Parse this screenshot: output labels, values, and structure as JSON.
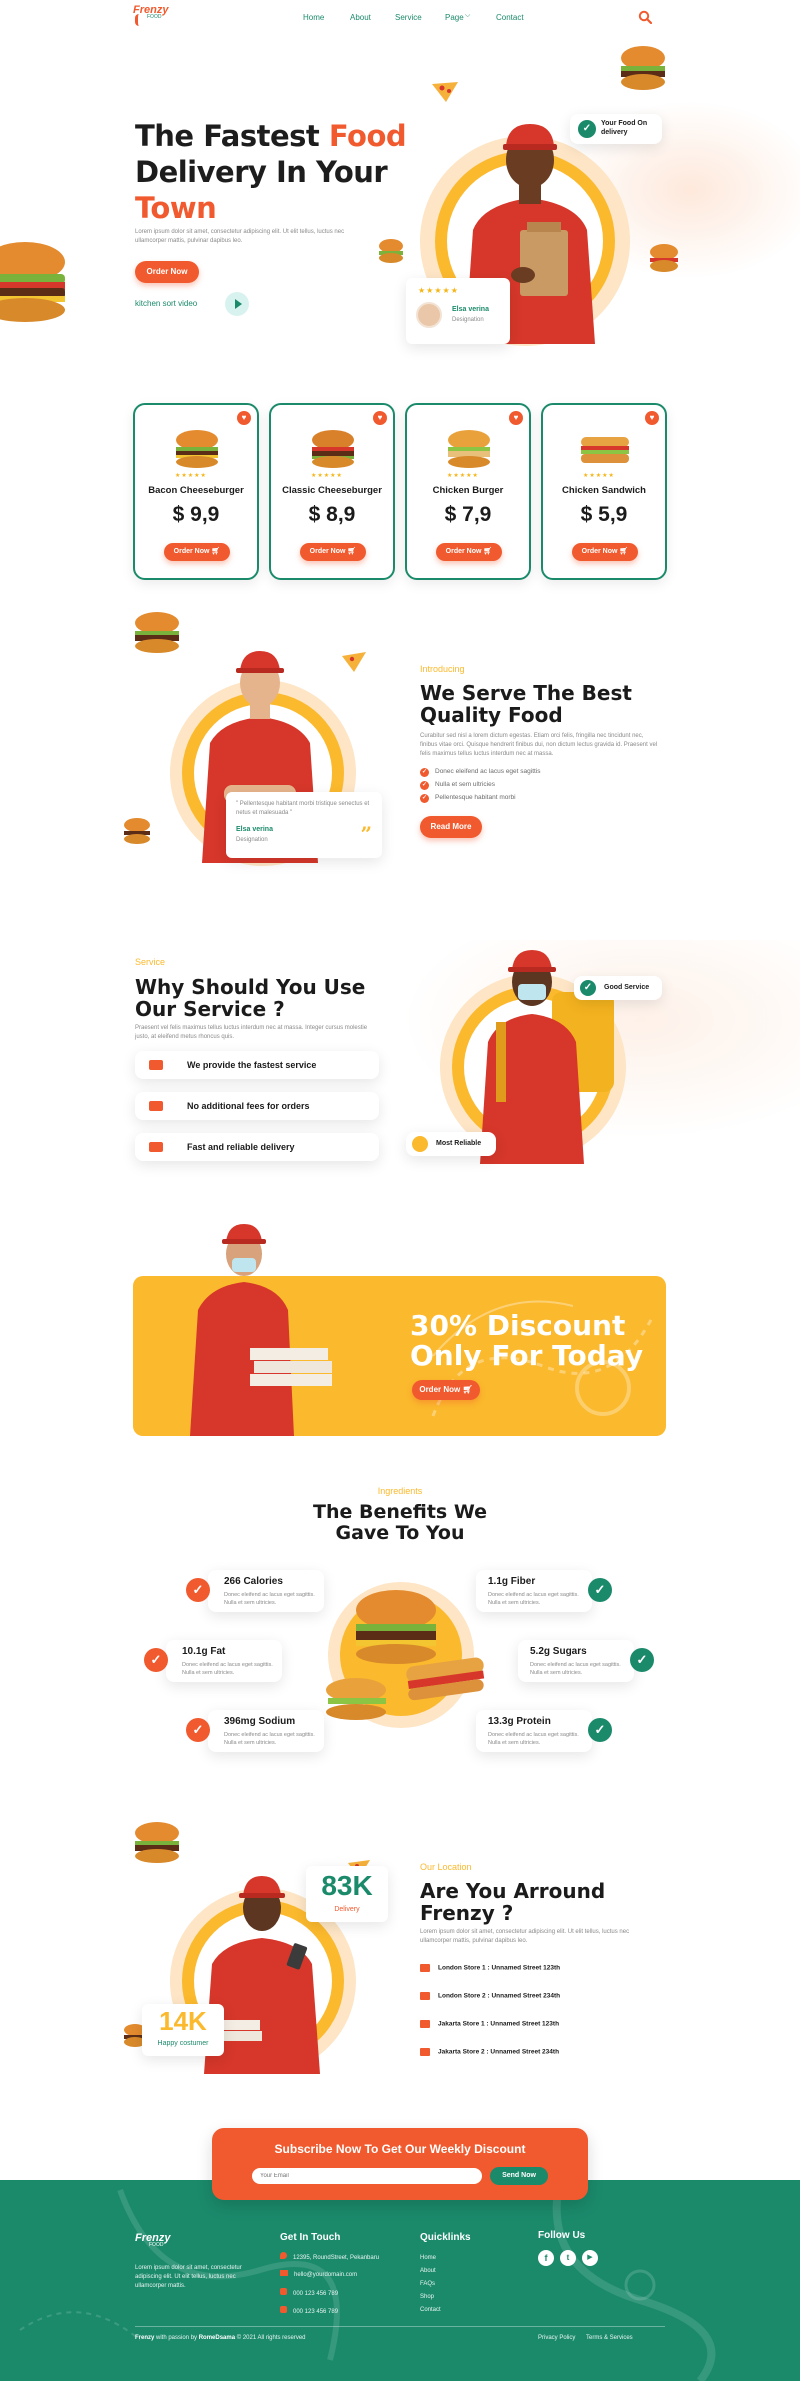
{
  "nav": {
    "logo": "Frenzy",
    "logo_sub": "FOOD",
    "links": [
      "Home",
      "About",
      "Service",
      "Page",
      "Contact"
    ],
    "page_caret": "⌵"
  },
  "hero": {
    "title_1": "The Fastest ",
    "title_food": "Food",
    "title_2": "Delivery In Your",
    "title_town": "Town",
    "desc": "Lorem ipsum dolor sit amet, consectetur adipiscing elit. Ut elit tellus, luctus nec ullamcorper mattis, pulvinar dapibus leo.",
    "order_button": "Order Now",
    "video_label": "kitchen sort video",
    "badge_text": "Your Food On delivery",
    "review_stars": "★★★★★",
    "review_name": "Elsa verina",
    "review_role": "Designation"
  },
  "products": [
    {
      "name": "Bacon Cheeseburger",
      "price": "$ 9,9",
      "stars": "★★★★★",
      "button": "Order Now"
    },
    {
      "name": "Classic Cheeseburger",
      "price": "$ 8,9",
      "stars": "★★★★★",
      "button": "Order Now"
    },
    {
      "name": "Chicken Burger",
      "price": "$ 7,9",
      "stars": "★★★★★",
      "button": "Order Now"
    },
    {
      "name": "Chicken Sandwich",
      "price": "$ 5,9",
      "stars": "★★★★★",
      "button": "Order Now"
    }
  ],
  "about": {
    "eyebrow": "Introducing",
    "title": "We Serve The Best Quality Food",
    "desc": "Curabitur sed nisl a lorem dictum egestas. Etiam orci felis, fringilla nec tincidunt nec, finibus vitae orci. Quisque hendrerit finibus dui, non dictum lectus gravida id. Praesent vel felis maximus tellus luctus interdum nec at massa.",
    "points": [
      "Donec eleifend ac lacus eget sagittis",
      "Nulla et sem ultricies",
      "Pellentesque habitant morbi"
    ],
    "button": "Read More",
    "quote": "\" Pellentesque habitant morbi tristique senectus et netus et malesuada \"",
    "quote_name": "Elsa verina",
    "quote_role": "Designation"
  },
  "service": {
    "eyebrow": "Service",
    "title": "Why Should You Use Our Service ?",
    "desc": "Praesent vel felis maximus tellus luctus interdum nec at massa. Integer cursus molestie justo, at eleifend metus rhoncus quis.",
    "items": [
      "We provide the fastest service",
      "No additional fees for orders",
      "Fast and reliable delivery"
    ],
    "badge_good": "Good Service",
    "badge_reliable": "Most Reliable"
  },
  "promo": {
    "line1": "30% Discount",
    "line2": "Only For Today",
    "button": "Order Now"
  },
  "benefits": {
    "eyebrow": "Ingredients",
    "title": "The Benefits We Gave To You",
    "desc": "Donec eleifend ac lacus eget sagittis. Nulla et sem ultricies.",
    "left": [
      "266 Calories",
      "10.1g Fat",
      "396mg Sodium"
    ],
    "right": [
      "1.1g Fiber",
      "5.2g Sugars",
      "13.3g Protein"
    ]
  },
  "location": {
    "eyebrow": "Our Location",
    "title": "Are You Arround Frenzy ?",
    "desc": "Lorem ipsum dolor sit amet, consectetur adipiscing elit. Ut elit tellus, luctus nec ullamcorper mattis, pulvinar dapibus leo.",
    "stores": [
      {
        "name": "London Store 1 :",
        "addr": "Unnamed Street 123th"
      },
      {
        "name": "London Store 2 :",
        "addr": "Unnamed Street 234th"
      },
      {
        "name": "Jakarta Store 1 :",
        "addr": "Unnamed Street 123th"
      },
      {
        "name": "Jakarta Store 2 :",
        "addr": "Unnamed Street 234th"
      }
    ],
    "stat1_value": "83K",
    "stat1_label": "Delivery",
    "stat2_value": "14K",
    "stat2_label": "Happy costumer"
  },
  "subscribe": {
    "title": "Subscribe Now To Get Our Weekly Discount",
    "placeholder": "Your Email",
    "button": "Send Now"
  },
  "footer": {
    "logo": "Frenzy",
    "logo_sub": "FOOD",
    "about": "Lorem ipsum dolor sit amet, consectetur adipiscing elit. Ut elit tellus, luctus nec ullamcorper mattis.",
    "contact_title": "Get In Touch",
    "contact": [
      "12395, RoundStreet, Pekanbaru",
      "hello@yourdomain.com",
      "000 123 456 789",
      "000 123 456 789"
    ],
    "links_title": "Quicklinks",
    "links": [
      "Home",
      "About",
      "FAQs",
      "Shop",
      "Contact"
    ],
    "follow_title": "Follow Us",
    "copyright_brand": "Frenzy",
    "copyright_mid": " with passion by ",
    "copyright_author": "RomeDsama",
    "copyright_end": " © 2021 All rights reserved",
    "privacy": "Privacy Policy",
    "terms": "Terms & Services"
  },
  "colors": {
    "accent": "#f05a2e",
    "teal": "#1b8a6b",
    "yellow": "#fbb92d"
  }
}
